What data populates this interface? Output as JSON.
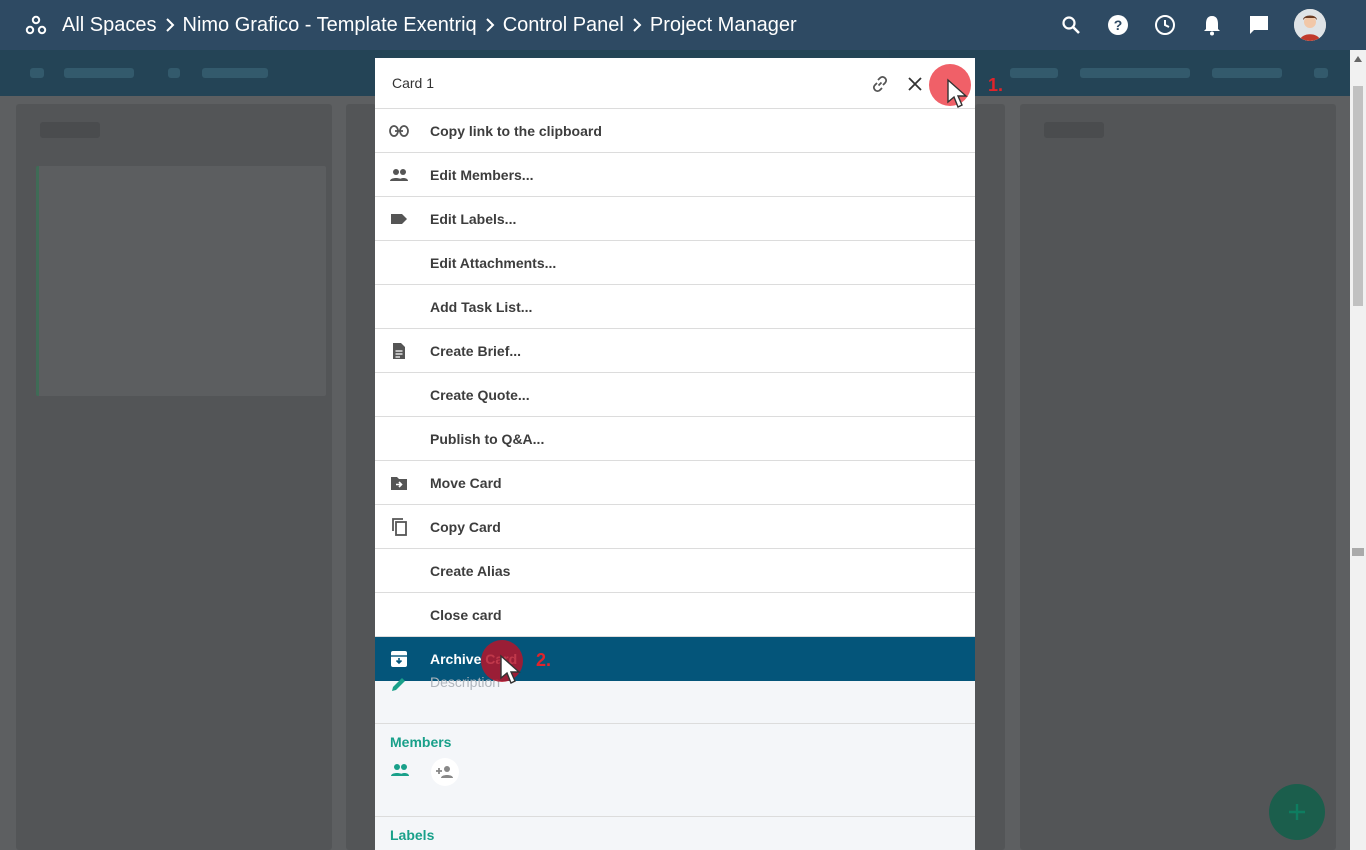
{
  "topbar": {
    "breadcrumbs": [
      "All Spaces",
      "Nimo Grafico - Template Exentriq",
      "Control Panel",
      "Project Manager"
    ],
    "icons": [
      "spaces-icon",
      "search-icon",
      "help-icon",
      "history-icon",
      "notifications-icon",
      "chat-icon",
      "user-avatar"
    ]
  },
  "modal": {
    "title": "Card 1",
    "header_icons": [
      "link-icon",
      "close-icon",
      "more-vert-icon"
    ],
    "menu": [
      {
        "label": "Copy link to the clipboard",
        "icon": "link-icon"
      },
      {
        "label": "Edit Members...",
        "icon": "people-icon"
      },
      {
        "label": "Edit Labels...",
        "icon": "label-icon"
      },
      {
        "label": "Edit Attachments...",
        "icon": ""
      },
      {
        "label": "Add Task List...",
        "icon": ""
      },
      {
        "label": "Create Brief...",
        "icon": "document-icon"
      },
      {
        "label": "Create Quote...",
        "icon": ""
      },
      {
        "label": "Publish to Q&A...",
        "icon": ""
      },
      {
        "label": "Move Card",
        "icon": "move-folder-icon"
      },
      {
        "label": "Copy Card",
        "icon": "copy-icon"
      },
      {
        "label": "Create Alias",
        "icon": ""
      },
      {
        "label": "Close card",
        "icon": ""
      },
      {
        "label": "Archive Card",
        "icon": "archive-icon",
        "highlighted": true
      }
    ],
    "description_placeholder": "Description",
    "members_title": "Members",
    "labels_title": "Labels"
  },
  "annotations": {
    "step1": "1.",
    "step2": "2."
  },
  "colors": {
    "topbar": "#2e4a63",
    "highlight": "#04557a",
    "accent_green": "#19a08a",
    "marker_red": "#e0242b"
  }
}
